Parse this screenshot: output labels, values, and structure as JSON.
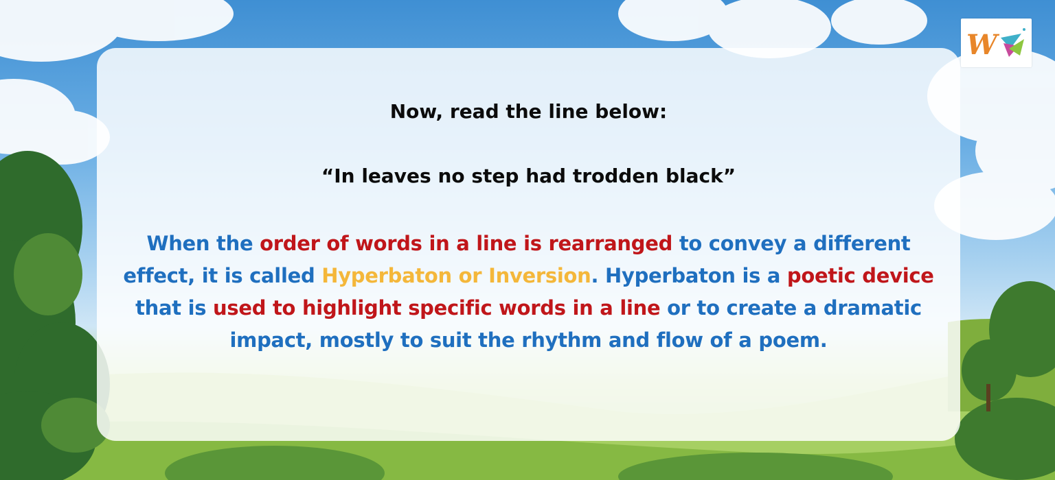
{
  "slide": {
    "heading": "Now, read the line below:",
    "quote": "“In leaves no step had trodden black”",
    "explanation": [
      {
        "text": "When the ",
        "color": "blue"
      },
      {
        "text": "order of words in a line is rearranged",
        "color": "red"
      },
      {
        "text": " to convey a different effect, it is called ",
        "color": "blue"
      },
      {
        "text": "Hyperbaton or Inversion",
        "color": "orange"
      },
      {
        "text": ". Hyperbaton is a ",
        "color": "blue"
      },
      {
        "text": "poetic device",
        "color": "red"
      },
      {
        "text": " that is ",
        "color": "blue"
      },
      {
        "text": "used to highlight specific words in a line",
        "color": "red"
      },
      {
        "text": " or to create a dramatic impact, mostly to suit the rhythm and flow of a poem.",
        "color": "blue"
      }
    ]
  },
  "colors": {
    "blue": "#1f6fbf",
    "red": "#c0161a",
    "orange": "#f4b73a",
    "heading": "#0b0b0b"
  },
  "background": {
    "icon": "sky-meadow-scene"
  },
  "logo": {
    "icon": "w-logo-icon"
  }
}
